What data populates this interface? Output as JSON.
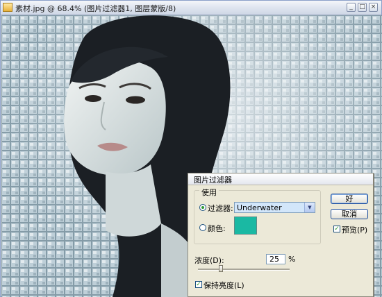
{
  "window": {
    "title": "素材.jpg @ 68.4% (图片过滤器1, 图层蒙版/8)",
    "buttons": {
      "minimize": "_",
      "maximize": "□",
      "close": "×"
    }
  },
  "dialog": {
    "title": "图片过滤器",
    "use_group_label": "使用",
    "filter_option": {
      "label": "过滤器:",
      "selected": true
    },
    "filter_select": {
      "value": "Underwater"
    },
    "color_option": {
      "label": "颜色:",
      "selected": false
    },
    "color_swatch_hex": "#1ab9a3",
    "ok_label": "好",
    "cancel_label": "取消",
    "preview": {
      "label": "预览(P)",
      "checked": true
    },
    "density": {
      "label": "浓度(D):",
      "value": "25",
      "unit": "%",
      "slider_fraction": 0.25
    },
    "preserve_luminosity": {
      "label": "保持亮度(L)",
      "checked": true
    }
  },
  "colors": {
    "photo_tint": "#9fb8c4",
    "hair": "#1b1f24",
    "skin": "#e7ebe9",
    "dialog_bg": "#ece9d8"
  },
  "icons": {
    "app": "photoshop-doc-icon",
    "select_arrow": "chevron-down-icon",
    "check": "checkmark-icon"
  }
}
